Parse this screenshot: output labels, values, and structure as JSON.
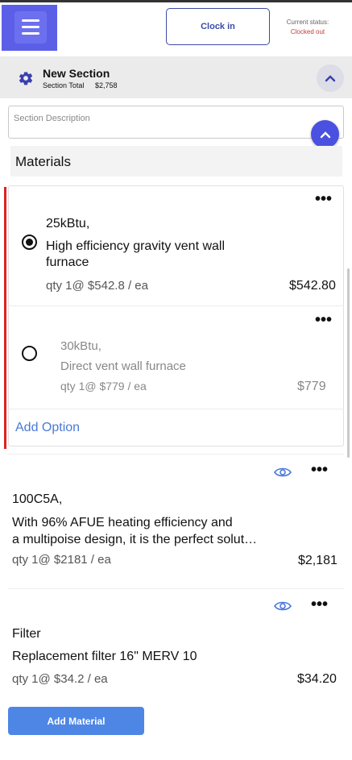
{
  "header": {
    "clock_in_label": "Clock in",
    "status_label": "Current status:",
    "status_value": "Clocked out"
  },
  "section": {
    "title": "New Section",
    "total_label": "Section Total",
    "total_value": "$2,758",
    "description_placeholder": "Section Description"
  },
  "materials": {
    "title": "Materials",
    "option_group": [
      {
        "selected": true,
        "name": "25kBtu,",
        "description_line1": "High efficiency gravity vent wall",
        "description_line2": "furnace",
        "qty": "qty 1@ $542.8 / ea",
        "price": "$542.80"
      },
      {
        "selected": false,
        "name": "30kBtu,",
        "description": "Direct vent wall furnace",
        "qty": "qty 1@ $779 / ea",
        "price": "$779"
      }
    ],
    "add_option_label": "Add Option",
    "items": [
      {
        "name": "100C5A,",
        "description_line1": "With 96% AFUE heating efficiency and",
        "description_line2": "a multipoise design, it is the perfect solut…",
        "qty": "qty 1@ $2181 / ea",
        "price": "$2,181"
      },
      {
        "name": "Filter",
        "description": "Replacement filter 16\" MERV 10",
        "qty": "qty 1@ $34.2 / ea",
        "price": "$34.20"
      }
    ],
    "add_material_label": "Add Material",
    "more_glyph": "•••"
  },
  "colors": {
    "accent": "#5b5fe8",
    "option_marker": "#e02020",
    "link": "#4a79d8",
    "status_clocked_out": "#c23b3b",
    "add_material_button": "#4e86e6"
  }
}
